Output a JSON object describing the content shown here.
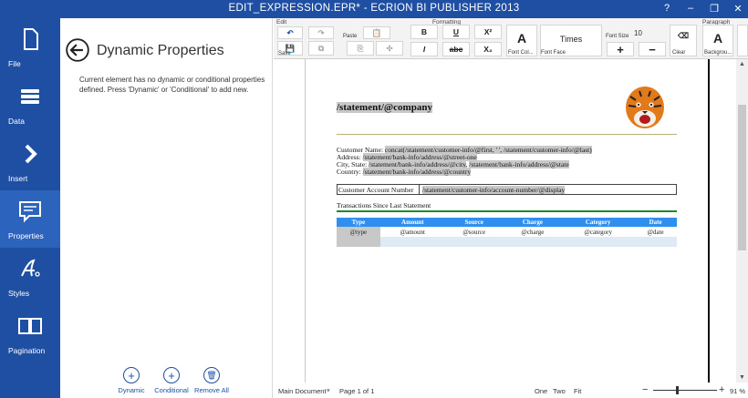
{
  "window": {
    "title": "EDIT_EXPRESSION.EPR* - ECRION BI PUBLISHER 2013",
    "help": "?",
    "minimize": "–",
    "restore": "❐",
    "close": "✕"
  },
  "nav": [
    {
      "label": "File",
      "icon": "file-icon"
    },
    {
      "label": "Data",
      "icon": "database-icon"
    },
    {
      "label": "Insert",
      "icon": "chevron-right-icon"
    },
    {
      "label": "Properties",
      "icon": "properties-icon"
    },
    {
      "label": "Styles",
      "icon": "styles-icon"
    },
    {
      "label": "Pagination",
      "icon": "pagination-icon"
    }
  ],
  "panel": {
    "title": "Dynamic Properties",
    "message": "Current element has no dynamic or conditional properties defined. Press 'Dynamic' or 'Conditional' to add new.",
    "actions": [
      {
        "label": "Dynamic",
        "glyph": "+"
      },
      {
        "label": "Conditional",
        "glyph": "+"
      },
      {
        "label": "Remove All",
        "glyph": "🗑"
      }
    ]
  },
  "ribbon": {
    "groups": {
      "edit": "Edit",
      "formatting": "Formatting",
      "paragraph": "Paragraph"
    },
    "save": "Save",
    "paste": "Paste",
    "bold": "B",
    "italic": "I",
    "underline": "U",
    "strike": "abc",
    "superscript": "X²",
    "subscript": "X₂",
    "font_color_label": "Font Col...",
    "font_face": "Times",
    "font_face_label": "Font Face",
    "font_size_label": "Font Size",
    "font_size": "10",
    "increase": "+",
    "decrease": "−",
    "clear": "Clear",
    "background_label": "Backgrou...",
    "big_a": "A"
  },
  "doc": {
    "company": "/statement/@company",
    "customer_name_label": "Customer Name:",
    "customer_name_value": "concat(/statement/customer-info/@first, ' ', /statement/customer-info/@last)",
    "address_label": "Address:",
    "address_value": "/statement/bank-info/address/@street-one",
    "city_label": "City, State:",
    "city_value": "/statement/bank-info/address/@city",
    "state_value": "/statement/bank-info/address/@state",
    "country_label": "Country:",
    "country_value": "/statement/bank-info/address/@country",
    "account_label": "Customer Account Number",
    "account_value": "/statement/customer-info/account-number/@display",
    "transactions_heading": "Transactions Since Last Statement",
    "table_headers": [
      "Type",
      "Amount",
      "Source",
      "Charge",
      "Category",
      "Date"
    ],
    "table_row": [
      "@type",
      "@amount",
      "@source",
      "@charge",
      "@category",
      "@date"
    ]
  },
  "status": {
    "main_document": "Main Document",
    "page": "Page 1 of 1",
    "one": "One",
    "two": "Two",
    "fit": "Fit",
    "zoom_out": "−",
    "zoom_in": "+",
    "zoom": "91 %"
  }
}
